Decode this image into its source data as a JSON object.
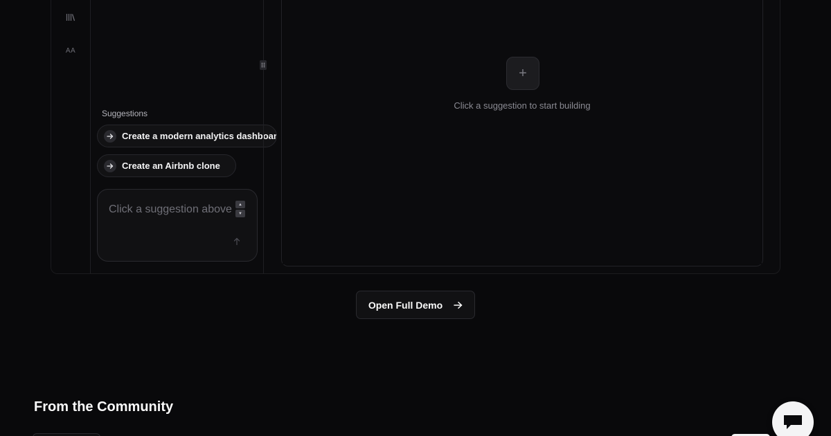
{
  "rail": {
    "icons": [
      "library-icon",
      "typography-icon"
    ],
    "typography_glyph": "AA"
  },
  "chat": {
    "suggestions_heading": "Suggestions",
    "suggestions": [
      {
        "label": "Create a modern analytics dashboard"
      },
      {
        "label": "Create an Airbnb clone"
      }
    ],
    "input": {
      "placeholder": "Click a suggestion above"
    }
  },
  "preview": {
    "hint": "Click a suggestion to start building",
    "add_glyph": "+"
  },
  "cta": {
    "open_demo_label": "Open Full Demo"
  },
  "community": {
    "heading": "From the Community"
  },
  "colors": {
    "background": "#09090b",
    "panel": "#0b0b0d",
    "border": "#2a2a2f",
    "text_primary": "#fafafa",
    "text_muted": "#8a8a92"
  }
}
